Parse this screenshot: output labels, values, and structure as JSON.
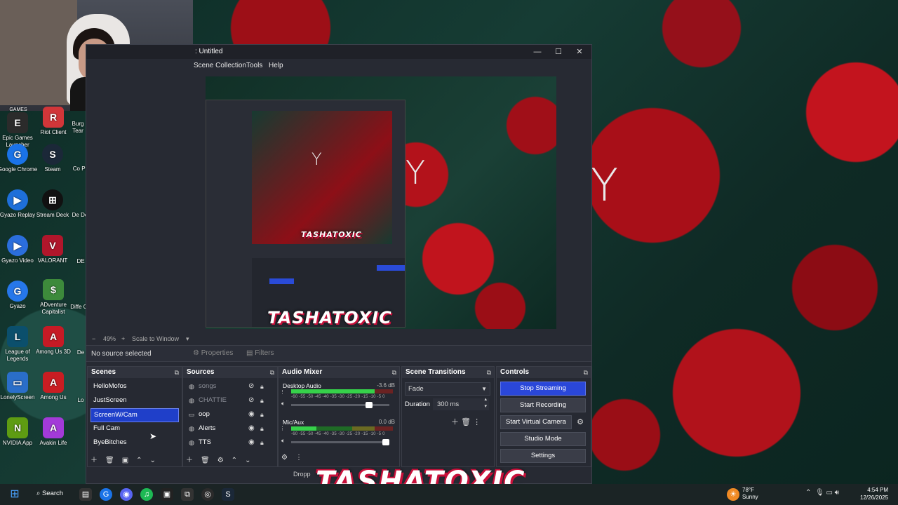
{
  "desktop": {
    "icons": [
      {
        "label": "Epic Games Launcher",
        "glyph": "E",
        "color": "#2b2b2b"
      },
      {
        "label": "Riot Client",
        "glyph": "R",
        "color": "#d13639"
      },
      {
        "label": "Google Chrome",
        "glyph": "G",
        "color": "#1a73e8"
      },
      {
        "label": "Steam",
        "glyph": "S",
        "color": "#1b2838"
      },
      {
        "label": "Gyazo Replay",
        "glyph": "▶",
        "color": "#1e6fd9"
      },
      {
        "label": "Stream Deck",
        "glyph": "⊞",
        "color": "#111"
      },
      {
        "label": "Gyazo Video",
        "glyph": "▶",
        "color": "#2b6edc"
      },
      {
        "label": "VALORANT",
        "glyph": "V",
        "color": "#b0162b"
      },
      {
        "label": "Gyazo",
        "glyph": "G",
        "color": "#2677ea"
      },
      {
        "label": "ADventure Capitalist",
        "glyph": "$",
        "color": "#3d8a3b"
      },
      {
        "label": "League of Legends",
        "glyph": "L",
        "color": "#0b4f6c"
      },
      {
        "label": "Among Us 3D",
        "glyph": "A",
        "color": "#c61a25"
      },
      {
        "label": "LonelyScreen",
        "glyph": "▭",
        "color": "#2a6ec9"
      },
      {
        "label": "Among Us",
        "glyph": "A",
        "color": "#c91d22"
      },
      {
        "label": "NVIDIA App",
        "glyph": "N",
        "color": "#5e9c12"
      },
      {
        "label": "Avakin Life",
        "glyph": "A",
        "color": "#a33ad8"
      }
    ],
    "partial_labels": [
      "Burg Tear",
      "Co Pr",
      "De De",
      "DE",
      "Diffe Or",
      "De",
      "Lo"
    ],
    "partial_top_label": "GAMES"
  },
  "obs": {
    "window_title": ": Untitled",
    "window_buttons": {
      "minimize": "—",
      "maximize": "☐",
      "close": "✕"
    },
    "menu": [
      "Scene Collection",
      "Tools",
      "Help"
    ],
    "zoom": {
      "percent": "49%",
      "mode": "Scale to Window"
    },
    "source_bar": {
      "status": "No source selected",
      "properties": "Properties",
      "filters": "Filters"
    },
    "scenes": {
      "title": "Scenes",
      "items": [
        "HelloMofos",
        "JustScreen",
        "ScreenW/Cam",
        "Full Cam",
        "ByeBitches"
      ],
      "selected_index": 2
    },
    "sources": {
      "title": "Sources",
      "items": [
        {
          "name": "songs",
          "hidden": true
        },
        {
          "name": "CHATTIE",
          "hidden": true
        },
        {
          "name": "oop",
          "hidden": false
        },
        {
          "name": "Alerts",
          "hidden": false
        },
        {
          "name": "TTS",
          "hidden": false
        }
      ]
    },
    "audio_mixer": {
      "title": "Audio Mixer",
      "ticks": "-60 -55 -50 -45 -40 -35 -30 -25 -20 -15 -10 -5 0",
      "channels": [
        {
          "name": "Desktop Audio",
          "db": "-3.6 dB",
          "level": 0.82,
          "volume": 0.83
        },
        {
          "name": "Mic/Aux",
          "db": "0.0 dB",
          "level": 0.25,
          "volume": 1.0
        }
      ]
    },
    "transitions": {
      "title": "Scene Transitions",
      "type": "Fade",
      "duration_label": "Duration",
      "duration_value": "300 ms"
    },
    "controls": {
      "title": "Controls",
      "buttons": [
        "Stop Streaming",
        "Start Recording",
        "Start Virtual Camera",
        "Studio Mode",
        "Settings"
      ]
    },
    "status_partial": "Dropp",
    "preview_letter": "Y"
  },
  "brand": {
    "overlay_text": "TASHATOXIC"
  },
  "taskbar": {
    "search": "Search",
    "weather_temp": "78°F",
    "weather_cond": "Sunny",
    "time": "4:54 PM",
    "date": "12/26/2025"
  },
  "colors": {
    "accent": "#2a47d9",
    "brand": "#c8103a"
  }
}
